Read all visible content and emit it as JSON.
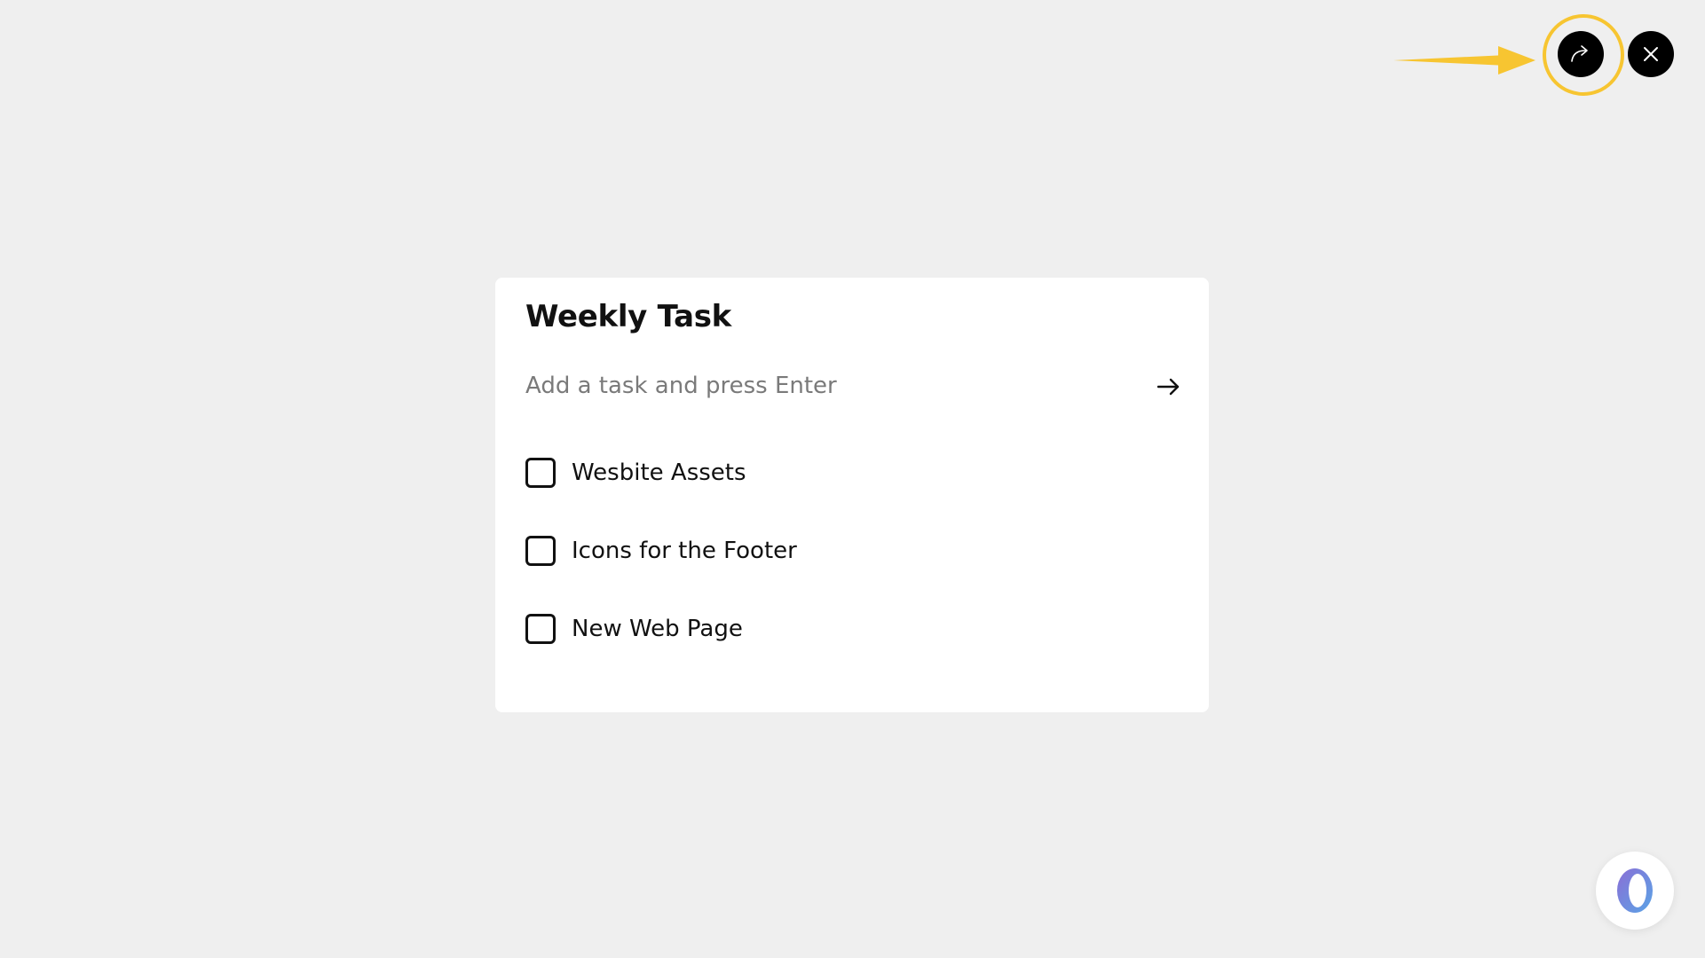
{
  "card": {
    "title": "Weekly Task",
    "input_placeholder": "Add a task and press Enter",
    "tasks": [
      {
        "label": "Wesbite Assets",
        "checked": false
      },
      {
        "label": "Icons for the Footer",
        "checked": false
      },
      {
        "label": "New Web Page",
        "checked": false
      }
    ]
  },
  "top_controls": {
    "share_icon": "share-forward-icon",
    "close_icon": "close-icon",
    "highlight_color": "#f7c531"
  },
  "assistant": {
    "icon": "assistant-logo-icon"
  },
  "colors": {
    "background": "#efefef",
    "card": "#ffffff",
    "button": "#000000",
    "annotation": "#f7c531"
  }
}
